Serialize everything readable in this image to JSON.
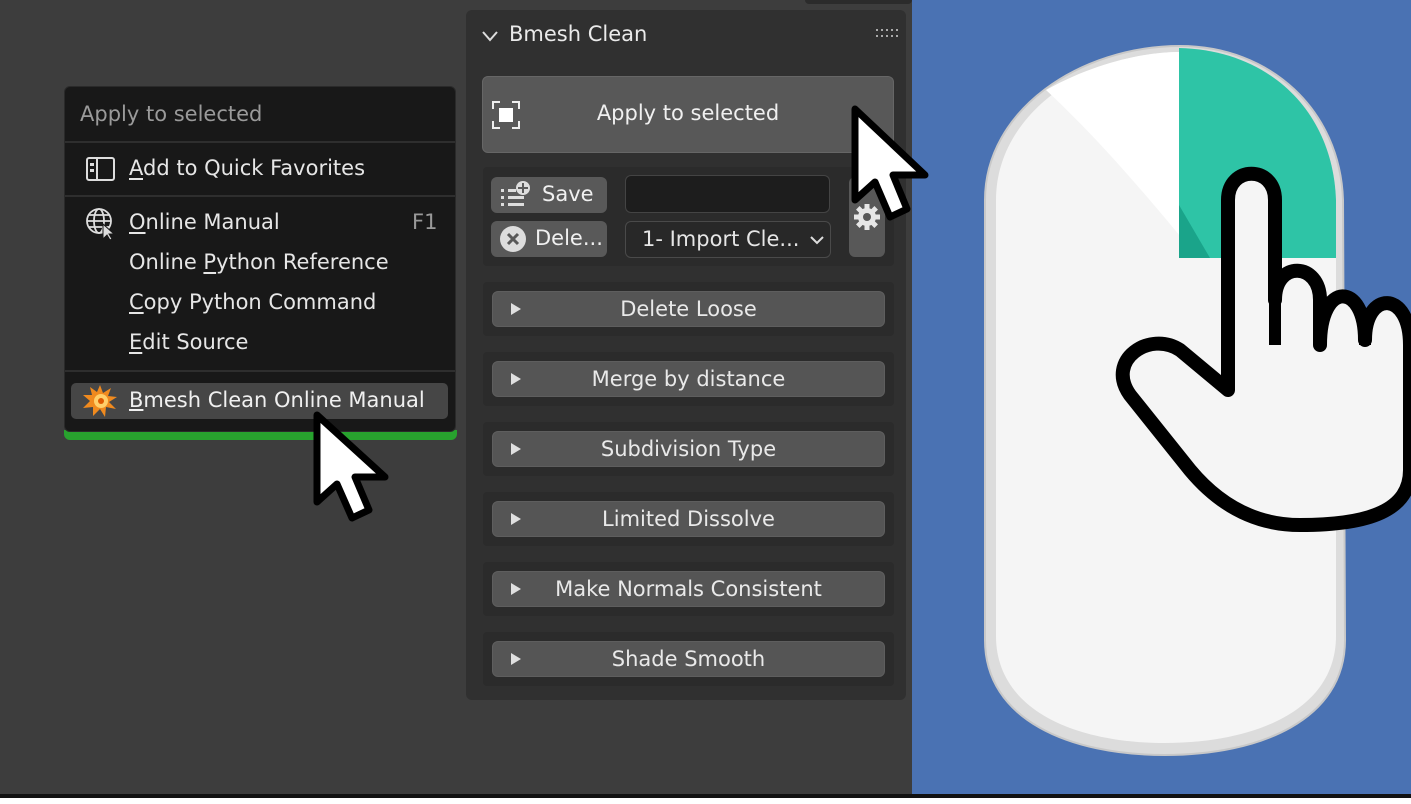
{
  "panel": {
    "title": "Bmesh Clean",
    "apply_label": "Apply to selected",
    "save_label": "Save",
    "delete_label": "Dele...",
    "preset_name_value": "",
    "preset_selected": "1- Import Cle...",
    "sections": [
      "Delete Loose",
      "Merge by distance",
      "Subdivision Type",
      "Limited Dissolve",
      "Make Normals Consistent",
      "Shade Smooth"
    ]
  },
  "context_menu": {
    "header": "Apply to selected",
    "items": {
      "add_favorites": {
        "u": "A",
        "rest": "dd to Quick Favorites"
      },
      "online_manual": {
        "u": "O",
        "rest": "nline Manual",
        "shortcut": "F1"
      },
      "python_ref": {
        "pre": "Online ",
        "u": "P",
        "rest": "ython Reference"
      },
      "copy_python": {
        "u": "C",
        "rest": "opy Python Command"
      },
      "edit_source": {
        "u": "E",
        "rest": "dit Source"
      },
      "bmesh_manual": {
        "u": "B",
        "rest": "mesh Clean Online Manual"
      }
    }
  },
  "colors": {
    "background": "#3d3d3d",
    "right_background": "#4a72b3",
    "accent_green": "#28a22e",
    "mouse_button": "#2ec4a6"
  },
  "icons": [
    "chevron-down-icon",
    "drag-grip-icon",
    "select-box-icon",
    "add-preset-icon",
    "delete-x-icon",
    "dropdown-chevron-icon",
    "gear-icon",
    "favorites-icon",
    "globe-cursor-icon",
    "addon-splash-icon",
    "mouse-pointer-icon",
    "mouse-illustration",
    "hand-pointer-icon"
  ]
}
